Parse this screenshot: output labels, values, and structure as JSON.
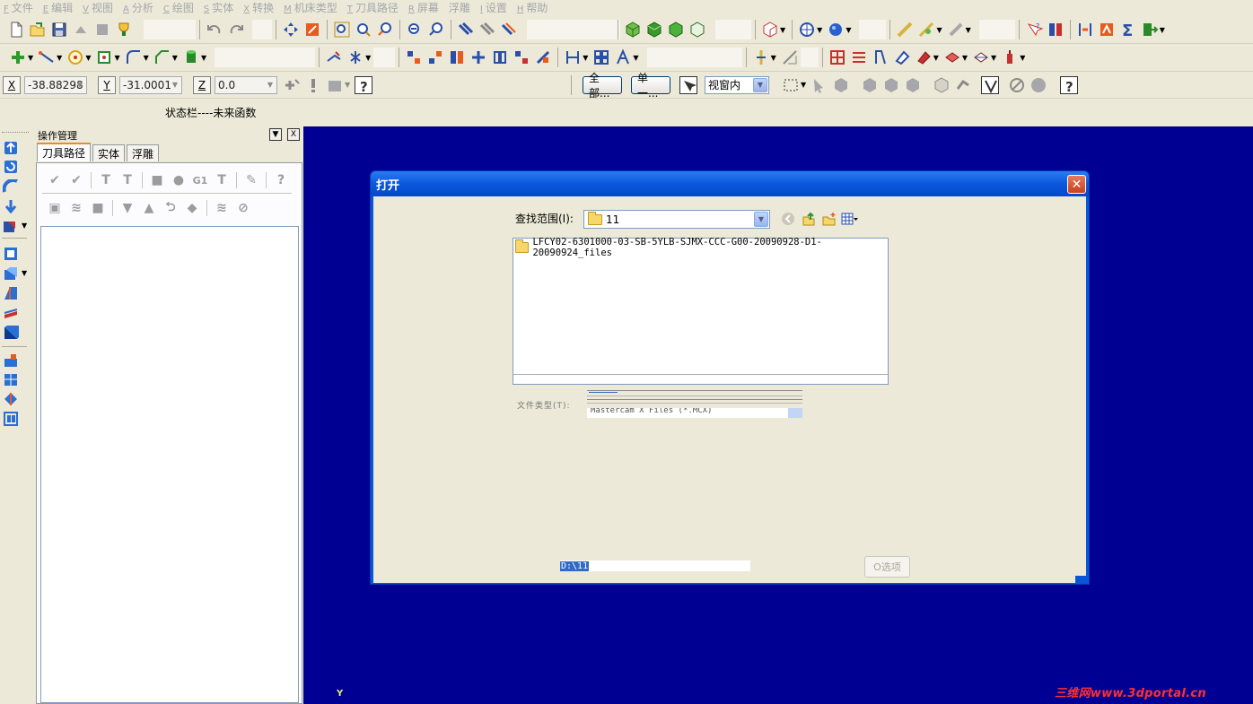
{
  "menubar": [
    {
      "key": "F",
      "label": "文件"
    },
    {
      "key": "E",
      "label": "编辑"
    },
    {
      "key": "V",
      "label": "视图"
    },
    {
      "key": "A",
      "label": "分析"
    },
    {
      "key": "C",
      "label": "绘图"
    },
    {
      "key": "S",
      "label": "实体"
    },
    {
      "key": "X",
      "label": "转换"
    },
    {
      "key": "M",
      "label": "机床类型"
    },
    {
      "key": "T",
      "label": "刀具路径"
    },
    {
      "key": "R",
      "label": "屏幕"
    },
    {
      "key": "",
      "label": "浮雕"
    },
    {
      "key": "I",
      "label": "设置"
    },
    {
      "key": "H",
      "label": "帮助"
    }
  ],
  "coords": {
    "x_label": "X",
    "x_value": "-38.88298",
    "y_label": "Y",
    "y_value": "-31.0001",
    "z_label": "Z",
    "z_value": "0.0"
  },
  "selection": {
    "all_button": "全部...",
    "single_button": "单一...",
    "window_mode": "视窗内"
  },
  "status_text": "状态栏----未来函数",
  "ops_manager": {
    "title": "操作管理",
    "pin_icon": "▼",
    "close_icon": "X",
    "tabs": [
      "刀具路径",
      "实体",
      "浮雕"
    ],
    "active_tab": 0
  },
  "graphics": {
    "coord_indicator": "Y",
    "watermark": "三维网www.3dportal.cn"
  },
  "dialog": {
    "title": "打开",
    "close_icon": "✕",
    "lookin_label": "查找范围(I):",
    "lookin_value": "11",
    "files": [
      "LFCY02-6301000-03-SB-5YLB-SJMX-CCC-G00-20090928-D1-20090924_files"
    ],
    "filetype_label": "文件类型(T):",
    "filetype_value": "Mastercam X Files (*.MCX)",
    "path_value": "D:\\11",
    "options_button": "O选项"
  },
  "colors": {
    "graphics_bg": "#000093",
    "dialog_title": "#0a58dc",
    "ui_bg": "#ece9d8"
  }
}
